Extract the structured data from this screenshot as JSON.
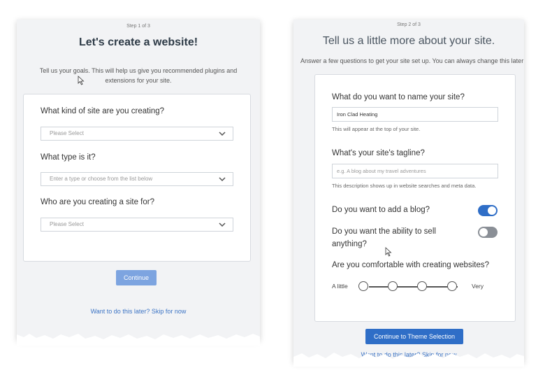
{
  "left": {
    "step": "Step 1 of 3",
    "title": "Let's create a website!",
    "subtitle": "Tell us your goals. This will help us give you recommended plugins and extensions for your site.",
    "q1": {
      "label": "What kind of site are you creating?",
      "placeholder": "Please Select"
    },
    "q2": {
      "label": "What type is it?",
      "placeholder": "Enter a type or choose from the list below"
    },
    "q3": {
      "label": "Who are you creating a site for?",
      "placeholder": "Please Select"
    },
    "continue_label": "Continue",
    "skip_link": "Want to do this later? Skip for now"
  },
  "right": {
    "step": "Step 2 of 3",
    "title": "Tell us a little more about your site.",
    "subtitle": "Answer a few questions to get your site set up. You can always change this later",
    "name_question": "What do you want to name your site?",
    "name_value": "Iron Clad Heating",
    "name_help": "This will appear at the top of your site.",
    "tagline_question": "What's your site's tagline?",
    "tagline_placeholder": "e.g. A blog about my travel adventures",
    "tagline_help": "This description shows up in website searches and meta data.",
    "blog_question": "Do you want to add a blog?",
    "blog_enabled": true,
    "sell_question_line1": "Do you want the ability to sell",
    "sell_question_line2": "anything?",
    "sell_enabled": false,
    "comfort_question": "Are you comfortable with creating websites?",
    "scale_low": "A little",
    "scale_high": "Very",
    "continue_label": "Continue to Theme Selection",
    "skip_link_partial": "Want to do this later? Skip for now"
  },
  "colors": {
    "primary_button": "#2f6ec7",
    "disabled_button": "#7da4e0",
    "toggle_on": "#2f6ec7",
    "toggle_off": "#8a8f96",
    "link": "#3b73c4"
  }
}
